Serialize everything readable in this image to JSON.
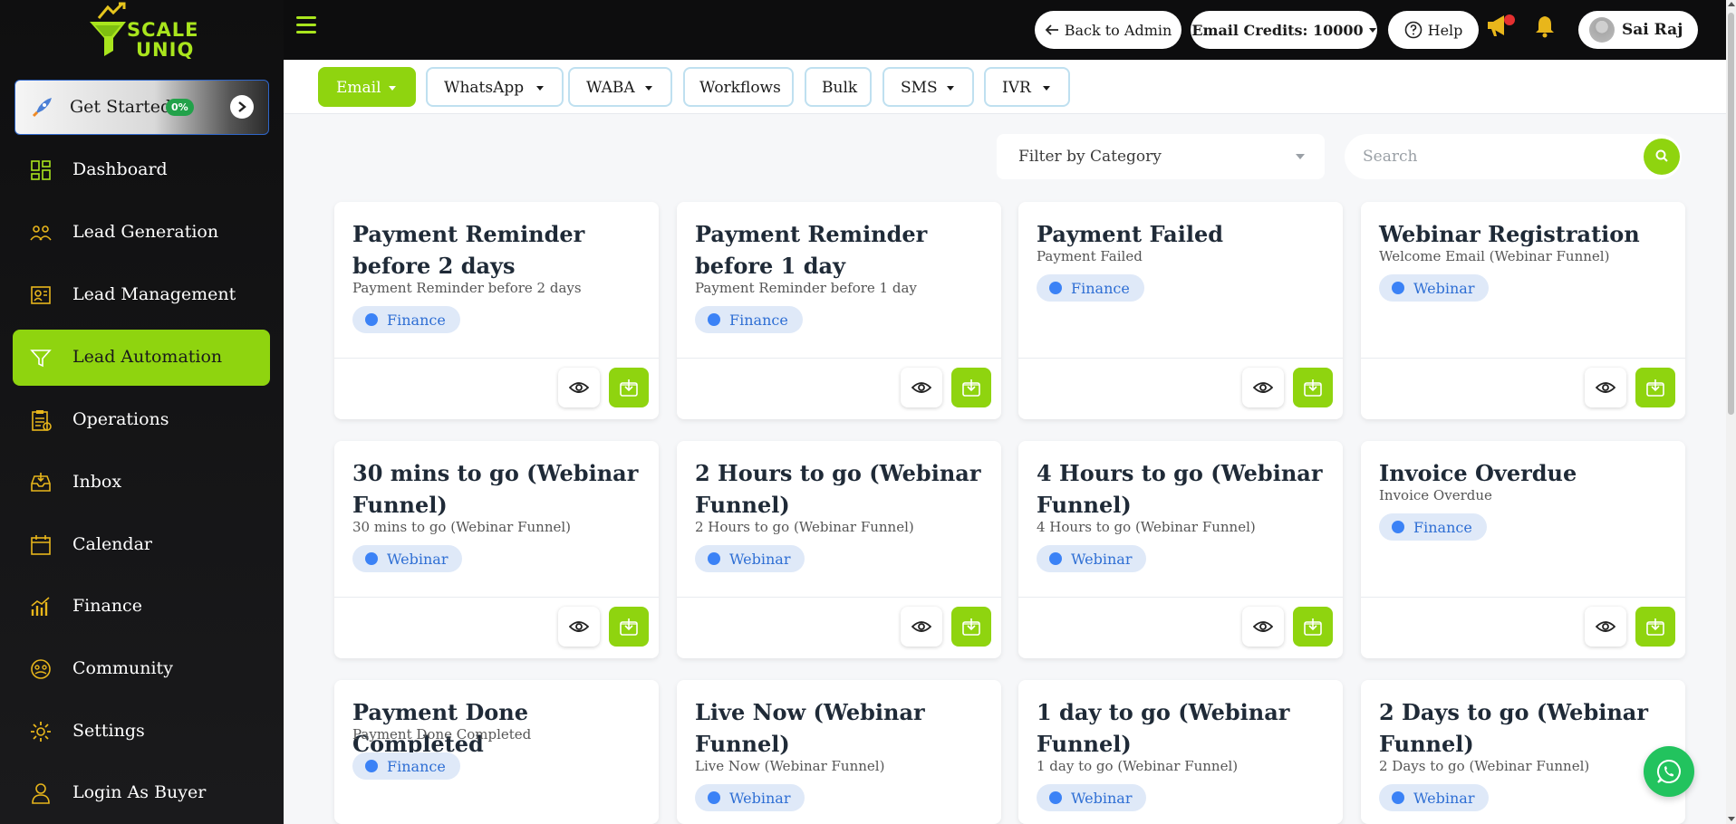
{
  "brand": {
    "line1": "SCALE",
    "line2": "UNIQ",
    "accent": "#8fd40f"
  },
  "get_started": {
    "label": "Get Started",
    "progress": "0%",
    "progress_value": 0
  },
  "sidebar": {
    "items": [
      {
        "label": "Dashboard",
        "icon": "dashboard-icon"
      },
      {
        "label": "Lead Generation",
        "icon": "users-icon"
      },
      {
        "label": "Lead Management",
        "icon": "id-card-icon"
      },
      {
        "label": "Lead Automation",
        "icon": "funnel-icon",
        "active": true
      },
      {
        "label": "Operations",
        "icon": "clipboard-icon"
      },
      {
        "label": "Inbox",
        "icon": "inbox-icon"
      },
      {
        "label": "Calendar",
        "icon": "calendar-icon"
      },
      {
        "label": "Finance",
        "icon": "finance-chart-icon"
      },
      {
        "label": "Community",
        "icon": "community-icon"
      },
      {
        "label": "Settings",
        "icon": "gear-icon"
      },
      {
        "label": "Login As Buyer",
        "icon": "user-icon"
      }
    ]
  },
  "topbar": {
    "back_label": "Back to Admin",
    "credits_label": "Email Credits: 10000",
    "help_label": "Help",
    "user_name": "Sai Raj"
  },
  "tabs": [
    {
      "label": "Email",
      "dropdown": true,
      "active": true
    },
    {
      "label": "WhatsApp",
      "dropdown": true
    },
    {
      "label": "WABA",
      "dropdown": true
    },
    {
      "label": "Workflows",
      "dropdown": false
    },
    {
      "label": "Bulk",
      "dropdown": false
    },
    {
      "label": "SMS",
      "dropdown": true
    },
    {
      "label": "IVR",
      "dropdown": true
    }
  ],
  "filters": {
    "category_label": "Filter by Category",
    "search_placeholder": "Search"
  },
  "cards": [
    {
      "title": "Payment Reminder before 2 days",
      "subtitle": "Payment Reminder before 2 days",
      "category": "Finance"
    },
    {
      "title": "Payment Reminder before 1 day",
      "subtitle": "Payment Reminder before 1 day",
      "category": "Finance"
    },
    {
      "title": "Payment Failed",
      "subtitle": "Payment Failed",
      "category": "Finance"
    },
    {
      "title": "Webinar Registration",
      "subtitle": "Welcome Email (Webinar Funnel)",
      "category": "Webinar"
    },
    {
      "title": "30 mins to go (Webinar Funnel)",
      "subtitle": "30 mins to go (Webinar Funnel)",
      "category": "Webinar"
    },
    {
      "title": "2 Hours to go (Webinar Funnel)",
      "subtitle": "2 Hours to go (Webinar Funnel)",
      "category": "Webinar"
    },
    {
      "title": "4 Hours to go (Webinar Funnel)",
      "subtitle": "4 Hours to go (Webinar Funnel)",
      "category": "Webinar"
    },
    {
      "title": "Invoice Overdue",
      "subtitle": "Invoice Overdue",
      "category": "Finance"
    },
    {
      "title": "Payment Done Completed",
      "subtitle": "Payment Done Completed",
      "category": "Finance"
    },
    {
      "title": "Live Now (Webinar Funnel)",
      "subtitle": "Live Now (Webinar Funnel)",
      "category": "Webinar"
    },
    {
      "title": "1 day to go (Webinar Funnel)",
      "subtitle": "1 day to go (Webinar Funnel)",
      "category": "Webinar"
    },
    {
      "title": "2 Days to go (Webinar Funnel)",
      "subtitle": "2 Days to go (Webinar Funnel)",
      "category": "Webinar"
    }
  ]
}
